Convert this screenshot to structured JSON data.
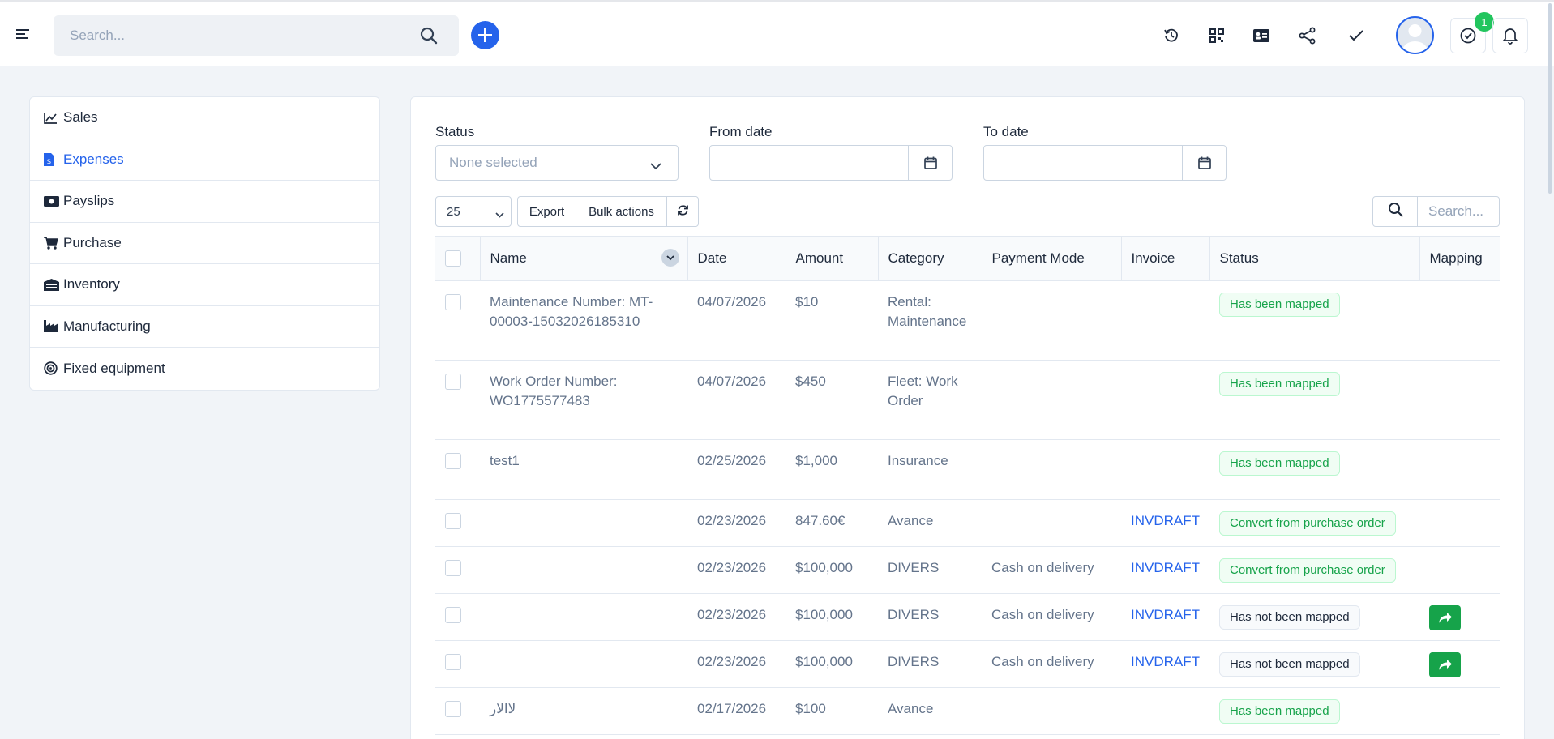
{
  "topbar": {
    "search_placeholder": "Search...",
    "notification_count": "1",
    "icons": [
      "menu-icon",
      "search-icon",
      "plus-icon",
      "history-icon",
      "qr-icon",
      "id-card-icon",
      "share-icon",
      "check-icon",
      "avatar",
      "clock-icon",
      "bell-icon"
    ]
  },
  "sidebar": {
    "items": [
      {
        "label": "Sales",
        "icon": "chart-line-icon"
      },
      {
        "label": "Expenses",
        "icon": "invoice-icon"
      },
      {
        "label": "Payslips",
        "icon": "money-icon"
      },
      {
        "label": "Purchase",
        "icon": "cart-icon"
      },
      {
        "label": "Inventory",
        "icon": "warehouse-icon"
      },
      {
        "label": "Manufacturing",
        "icon": "industry-icon"
      },
      {
        "label": "Fixed equipment",
        "icon": "target-icon"
      }
    ],
    "active": "Expenses"
  },
  "filters": {
    "status_label": "Status",
    "status_placeholder": "None selected",
    "from_label": "From date",
    "to_label": "To date"
  },
  "toolbar": {
    "page_size": "25",
    "export_label": "Export",
    "bulk_label": "Bulk actions",
    "search_placeholder": "Search..."
  },
  "table": {
    "columns": [
      "Name",
      "Date",
      "Amount",
      "Category",
      "Payment Mode",
      "Invoice",
      "Status",
      "Mapping"
    ],
    "rows": [
      {
        "name": "Maintenance Number: MT-00003-15032026185310",
        "date": "04/07/2026",
        "amount": "$10",
        "category": "Rental: Maintenance",
        "payment_mode": "",
        "invoice": "",
        "status": "Has been mapped",
        "mapping": false
      },
      {
        "name": "Work Order Number: WO1775577483",
        "date": "04/07/2026",
        "amount": "$450",
        "category": "Fleet: Work Order",
        "payment_mode": "",
        "invoice": "",
        "status": "Has been mapped",
        "mapping": false
      },
      {
        "name": "test1",
        "date": "02/25/2026",
        "amount": "$1,000",
        "category": "Insurance",
        "payment_mode": "",
        "invoice": "",
        "status": "Has been mapped",
        "mapping": false
      },
      {
        "name": "",
        "date": "02/23/2026",
        "amount": "847.60€",
        "category": "Avance",
        "payment_mode": "",
        "invoice": "INVDRAFT",
        "status": "Convert from purchase order",
        "mapping": false
      },
      {
        "name": "",
        "date": "02/23/2026",
        "amount": "$100,000",
        "category": "DIVERS",
        "payment_mode": "Cash on delivery",
        "invoice": "INVDRAFT",
        "status": "Convert from purchase order",
        "mapping": false
      },
      {
        "name": "",
        "date": "02/23/2026",
        "amount": "$100,000",
        "category": "DIVERS",
        "payment_mode": "Cash on delivery",
        "invoice": "INVDRAFT",
        "status": "Has not been mapped",
        "mapping": true
      },
      {
        "name": "",
        "date": "02/23/2026",
        "amount": "$100,000",
        "category": "DIVERS",
        "payment_mode": "Cash on delivery",
        "invoice": "INVDRAFT",
        "status": "Has not been mapped",
        "mapping": true
      },
      {
        "name": "ﻻﺍﻻﺭ",
        "date": "02/17/2026",
        "amount": "$100",
        "category": "Avance",
        "payment_mode": "",
        "invoice": "",
        "status": "Has been mapped",
        "mapping": false
      }
    ]
  },
  "colors": {
    "accent": "#2563eb",
    "success": "#16a34a",
    "badge": "#22c55e"
  }
}
